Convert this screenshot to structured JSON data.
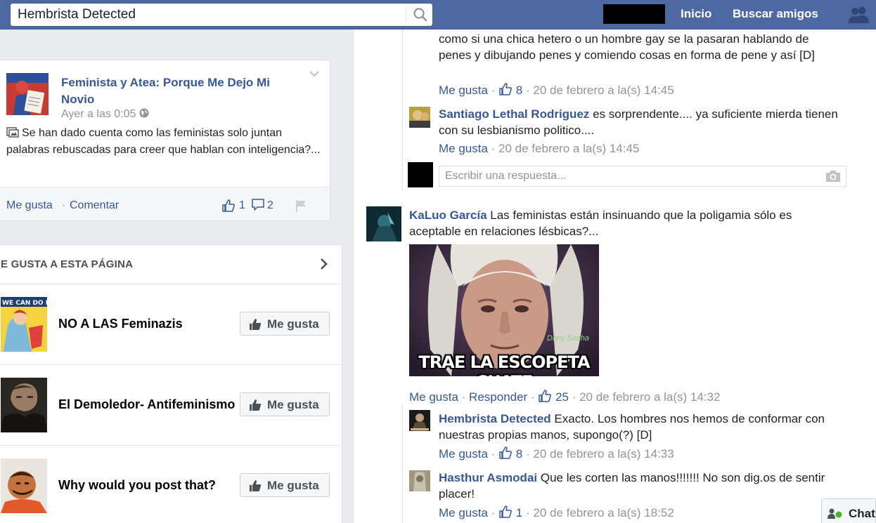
{
  "topbar": {
    "search_value": "Hembrista Detected",
    "nav_home": "Inicio",
    "nav_find_friends": "Buscar amigos"
  },
  "post": {
    "title": "Feminista y Atea: Porque Me Dejo Mi Novio",
    "time": "Ayer a las 0:05",
    "text": "Se han dado cuenta como las feministas solo juntan palabras rebuscadas para creer que hablan con inteligencia?...",
    "like_label": "Me gusta",
    "comment_label": "Comentar",
    "like_count": "1",
    "comment_count": "2"
  },
  "likes_section": {
    "heading": "E GUSTA A ESTA PÁGINA",
    "button_label": "Me gusta",
    "pages": [
      {
        "name": "NO A LAS Feminazis",
        "thumb_text": "WE CAN DO IT!"
      },
      {
        "name": "El Demoledor- Antifeminismo"
      },
      {
        "name": "Why would you post that?"
      }
    ]
  },
  "comments": {
    "partial_text": "como si una chica hetero o un hombre gay se la pasaran hablando de penes y dibujando penes y comiendo cosas en forma de pene y así [D]",
    "partial_meta": {
      "like": "Me gusta",
      "count": "8",
      "time": "20 de febrero a la(s) 14:45"
    },
    "reply1": {
      "name": "Santiago Lethal Rodriguez",
      "text": " es sorprendente.... ya suficiente mierda tienen con su lesbianismo politico....",
      "like": "Me gusta",
      "time": "20 de febrero a la(s) 14:45"
    },
    "reply_placeholder": "Escribir una respuesta...",
    "main": {
      "name": "KaLuo García",
      "text": " Las feministas están insinuando que la poligamia sólo es aceptable en relaciones lésbicas?...",
      "meme_caption": "TRAE LA ESCOPETA CUATE",
      "meme_watermark": "Dany Sasha",
      "like": "Me gusta",
      "reply": "Responder",
      "count": "25",
      "time": "20 de febrero a la(s) 14:32"
    },
    "reply2": {
      "name": "Hembrista Detected",
      "text": " Exacto. Los hombres nos hemos de conformar con nuestras propias manos, supongo(?) [D]",
      "like": "Me gusta",
      "count": "8",
      "time": "20 de febrero a la(s) 14:33"
    },
    "reply3": {
      "name": "Hasthur Asmodai",
      "text": " Que les corten las manos!!!!!!! No son dig.os de sentir placer!",
      "like": "Me gusta",
      "count": "1",
      "time": "20 de febrero a la(s) 18:52"
    }
  },
  "chat": {
    "label": "Chat"
  },
  "colors": {
    "brand_blue": "#4e69a2",
    "link_blue": "#365899",
    "meta_gray": "#90949c",
    "online_green": "#42b72a"
  }
}
